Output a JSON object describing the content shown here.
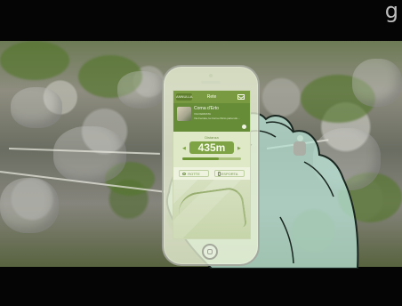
{
  "app": {
    "back_label": "ANNULLA",
    "title": "Rete"
  },
  "hero": {
    "place": "Corna d'Erto",
    "subtitle": "VIA FERRATA",
    "description": "Via Ferrata, la Corna d'Erto partendo..."
  },
  "distance": {
    "label": "Distanza",
    "value": "435m",
    "progress": 0.62
  },
  "actions": {
    "route_label": "ROTTE",
    "export_label": "ESPORTA"
  },
  "icons": {
    "back": "arrow-left-icon",
    "mail": "mail-icon",
    "info": "info-icon",
    "route": "eye-icon",
    "export": "export-icon",
    "home": "home-button-icon",
    "corner": "partial-mark-icon"
  },
  "overlay": {
    "corner_mark": "g"
  },
  "colors": {
    "app_green": "#7a9a42",
    "panel_green": "#dfe9c7",
    "value_green": "#7ea345",
    "hand_fill": "#b8e3d6",
    "climber_red": "#7f1313"
  }
}
